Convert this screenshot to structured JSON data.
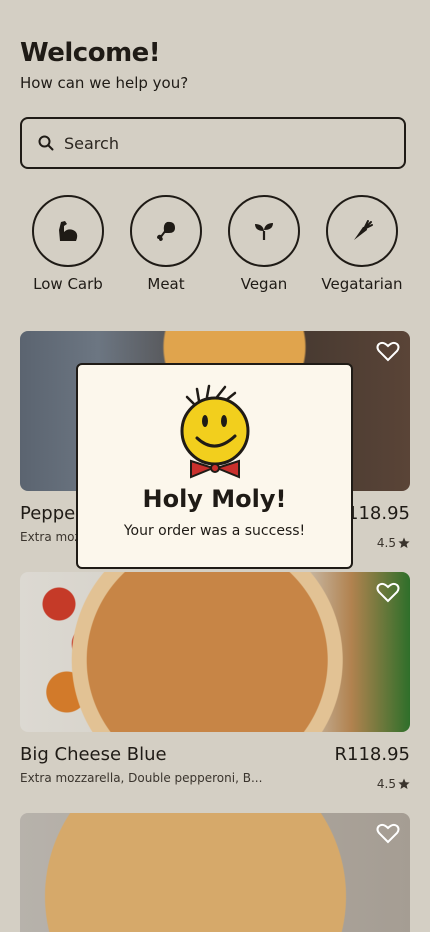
{
  "header": {
    "title": "Welcome!",
    "subtitle": "How can we help you?"
  },
  "search": {
    "placeholder": "Search",
    "icon": "search-icon"
  },
  "categories": [
    {
      "label": "Low Carb",
      "icon": "muscle-icon"
    },
    {
      "label": "Meat",
      "icon": "meat-drumstick-icon"
    },
    {
      "label": "Vegan",
      "icon": "sprout-icon"
    },
    {
      "label": "Vegatarian",
      "icon": "carrot-icon"
    }
  ],
  "products": [
    {
      "name": "Pepper",
      "price": "R118.95",
      "description": "Extra moz",
      "rating": "4.5"
    },
    {
      "name": "Big Cheese Blue",
      "price": "R118.95",
      "description": "Extra mozzarella, Double pepperoni, B...",
      "rating": "4.5"
    },
    {
      "name": "",
      "price": "",
      "description": "",
      "rating": ""
    }
  ],
  "modal": {
    "title": "Holy Moly!",
    "message": "Your order was a success!",
    "icon": "smiley-mascot-icon"
  },
  "colors": {
    "background": "#d4cfc4",
    "text": "#1f1b16",
    "modal_bg": "#fcf7ec",
    "mascot_yellow": "#f2cf1d",
    "mascot_red": "#c8302c"
  }
}
